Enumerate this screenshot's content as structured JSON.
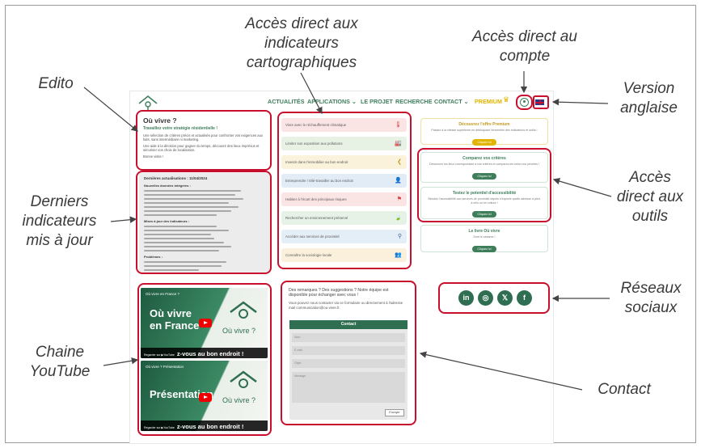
{
  "annotations": {
    "acces_indicateurs": "Accès direct aux indicateurs cartographiques",
    "acces_indicateurs_l1": "Accès direct aux",
    "acces_indicateurs_l2": "indicateurs",
    "acces_indicateurs_l3": "cartographiques",
    "acces_compte_l1": "Accès direct au",
    "acces_compte_l2": "compte",
    "edito": "Edito",
    "version_l1": "Version",
    "version_l2": "anglaise",
    "derniers_l1": "Derniers",
    "derniers_l2": "indicateurs",
    "derniers_l3": "mis à jour",
    "outils_l1": "Accès",
    "outils_l2": "direct aux",
    "outils_l3": "outils",
    "reseaux_l1": "Réseaux",
    "reseaux_l2": "sociaux",
    "chaine_l1": "Chaine",
    "chaine_l2": "YouTube",
    "contact": "Contact"
  },
  "nav": {
    "actualites": "ACTUALITÉS",
    "applications": "APPLICATIONS ⌄",
    "projet": "LE PROJET",
    "recherche": "RECHERCHE",
    "contact": "CONTACT ⌄",
    "premium": "PREMIUM"
  },
  "edito": {
    "title": "Où vivre ?",
    "subtitle": "Travaillez votre stratégie résidentielle !",
    "p1": "Une sélection de critères précis et actualisés pour confronter vos exigences aux faits, sans intermédiaire ni marketing.",
    "p2": "Une aide à la décision pour gagner du temps, découvrir des lieux imprévus et sécuriser vos choix de localisation.",
    "p3": "Bonne visite !"
  },
  "latest": {
    "heading": "Dernières actualisations : 11/04/2024",
    "sec1": "Nouvelles données intégrées :",
    "sec2": "Mises à jour des indicateurs :",
    "sec3": "Problèmes :"
  },
  "indicators": [
    {
      "label": "Vivre avec le réchauffement climatique",
      "icon": "🌡",
      "color": "#fbe4e4"
    },
    {
      "label": "Limiter son exposition aux pollutions",
      "icon": "🏭",
      "color": "#e7f2e4"
    },
    {
      "label": "Investir dans l'immobilier au bon endroit",
      "icon": "❮",
      "color": "#fbf2dc"
    },
    {
      "label": "Entreprendre / télé-travailler au bon endroit",
      "icon": "👤",
      "color": "#e1ecf7"
    },
    {
      "label": "Habiter à l'écart des principaux risques",
      "icon": "⚑",
      "color": "#fbe4e4"
    },
    {
      "label": "Rechercher un environnement préservé",
      "icon": "🍃",
      "color": "#e5f2e5"
    },
    {
      "label": "Accéder aux services de proximité",
      "icon": "⚲",
      "color": "#e4eef6"
    },
    {
      "label": "Connaître la sociologie locale",
      "icon": "👥",
      "color": "#fbf0dc"
    }
  ],
  "tools": {
    "premium_title": "Découvrez l'offre Premium",
    "premium_desc": "Passez à la vitesse supérieure en débloquant l'ensemble des indicateurs et outils !",
    "premium_btn": "Cliquez ici",
    "criteres_title": "Comparez vos critères",
    "criteres_desc": "Découvrez les lieux correspondant à vos critères et comparez-les selon vos priorités !",
    "criteres_btn": "Cliquez ici",
    "access_title": "Testez le potentiel d'accessibilité",
    "access_desc": "Simulez l'accessibilité aux services de proximité depuis n'importe quelle adresse à pied, à vélo ou en voiture !",
    "access_btn": "Cliquez ici",
    "livre_title": "Le livre Où vivre",
    "livre_desc": "Dont le sésame !",
    "livre_btn": "Cliquez ici"
  },
  "youtube": [
    {
      "channel": "Où vivre en France ?",
      "big": "Où vivre en France",
      "ov": "Où vivre ?",
      "watch": "Regarder sur ▶YouTube",
      "tagline": "z-vous au bon endroit !"
    },
    {
      "channel": "Où vivre ? Présentation",
      "big": "Présentation",
      "ov": "Où vivre ?",
      "watch": "Regarder sur ▶YouTube",
      "tagline": "z-vous au bon endroit !"
    }
  ],
  "contact": {
    "q1": "Des remarques ? Des suggestions ? Notre équipe est disponible pour échanger avec vous !",
    "q2": "Vous pouvez nous contacter via ce formulaire ou directement à l'adresse mail communication@ou-vivre.fr.",
    "form_title": "Contact",
    "f_nom": "Nom",
    "f_email": "E-mail",
    "f_objet": "Objet",
    "f_message": "Message",
    "send": "Envoyer"
  },
  "social": [
    "in",
    "◎",
    "𝕏",
    "f"
  ],
  "colors": {
    "red": "#c8102e",
    "green": "#3f7e5b",
    "gold": "#e0b400"
  }
}
